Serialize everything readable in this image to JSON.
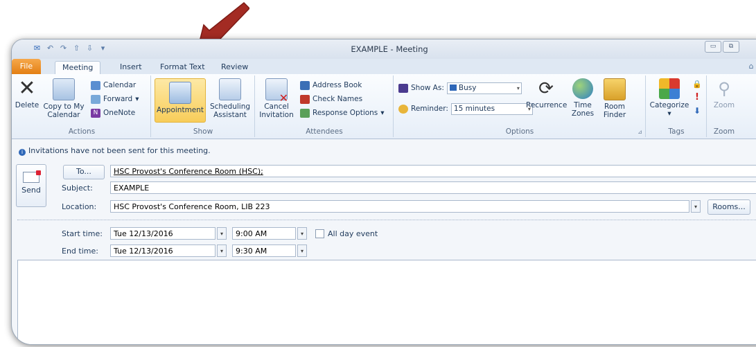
{
  "window": {
    "title": "EXAMPLE - Meeting"
  },
  "colors": {
    "file_tab": "#e37f14",
    "accent_blue": "#2e67b8",
    "arrow": "#a32b23",
    "selected_button": "#f8cd5a"
  },
  "tabs": [
    {
      "label": "File"
    },
    {
      "label": "Meeting"
    },
    {
      "label": "Insert"
    },
    {
      "label": "Format Text"
    },
    {
      "label": "Review"
    }
  ],
  "ribbon": {
    "actions": {
      "label": "Actions",
      "delete": "Delete",
      "copy_line1": "Copy to My",
      "copy_line2": "Calendar",
      "calendar": "Calendar",
      "forward": "Forward",
      "onenote": "OneNote"
    },
    "show": {
      "label": "Show",
      "appointment": "Appointment",
      "scheduling_line1": "Scheduling",
      "scheduling_line2": "Assistant"
    },
    "attendees": {
      "label": "Attendees",
      "cancel_line1": "Cancel",
      "cancel_line2": "Invitation",
      "address_book": "Address Book",
      "check_names": "Check Names",
      "response_options": "Response Options"
    },
    "options": {
      "label": "Options",
      "show_as_label": "Show As:",
      "show_as_value": "Busy",
      "reminder_label": "Reminder:",
      "reminder_value": "15 minutes",
      "recurrence": "Recurrence",
      "time_zones_line1": "Time",
      "time_zones_line2": "Zones",
      "room_finder_line1": "Room",
      "room_finder_line2": "Finder"
    },
    "tags": {
      "label": "Tags",
      "categorize": "Categorize"
    },
    "zoom": {
      "label": "Zoom",
      "zoom": "Zoom"
    }
  },
  "infobar": {
    "text": "Invitations have not been sent for this meeting."
  },
  "form": {
    "send": "Send",
    "to_button": "To...",
    "to_value": "HSC Provost's Conference Room (HSC);",
    "subject_label": "Subject:",
    "subject_value": "EXAMPLE",
    "location_label": "Location:",
    "location_value": "HSC Provost's Conference Room, LIB 223",
    "rooms_button": "Rooms...",
    "start_label": "Start time:",
    "start_date": "Tue 12/13/2016",
    "start_time": "9:00 AM",
    "all_day": "All day event",
    "end_label": "End time:",
    "end_date": "Tue 12/13/2016",
    "end_time": "9:30 AM"
  }
}
